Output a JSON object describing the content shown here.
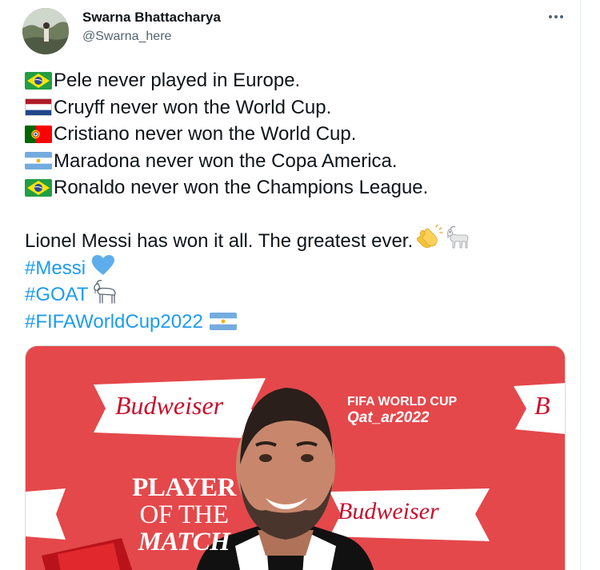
{
  "author": {
    "name": "Swarna Bhattacharya",
    "handle": "@Swarna_here"
  },
  "more_icon": "more-horizontal-icon",
  "tweet": {
    "lines": [
      {
        "flag": "brazil-flag-icon",
        "text": "Pele never played in Europe."
      },
      {
        "flag": "netherlands-flag-icon",
        "text": "Cruyff never won the World Cup."
      },
      {
        "flag": "portugal-flag-icon",
        "text": "Cristiano never won the World Cup."
      },
      {
        "flag": "argentina-flag-icon",
        "text": "Maradona never won the Copa America."
      },
      {
        "flag": "brazil-flag-icon",
        "text": "Ronaldo never won the Champions League."
      }
    ],
    "conclusion": "Lionel Messi has won it all. The greatest ever.",
    "conclusion_emojis": [
      "clapping-hands-icon",
      "goat-icon"
    ],
    "hashtags": [
      {
        "text": "#Messi",
        "emoji": "blue-heart-icon"
      },
      {
        "text": "#GOAT",
        "emoji": "goat-icon"
      },
      {
        "text": "#FIFAWorldCup2022",
        "emoji": "argentina-flag-icon"
      }
    ]
  },
  "media": {
    "bud_text": "Budweiser",
    "fifa_line1": "FIFA WORLD CUP",
    "fifa_line2": "Qat_ar2022",
    "potm": [
      "PLAYER",
      "OF THE",
      "MATCH"
    ],
    "colors": {
      "background": "#e4484b",
      "brand": "#c8102e"
    }
  },
  "colors": {
    "link": "#1d9bf0",
    "text": "#0f1419",
    "muted": "#536471"
  }
}
